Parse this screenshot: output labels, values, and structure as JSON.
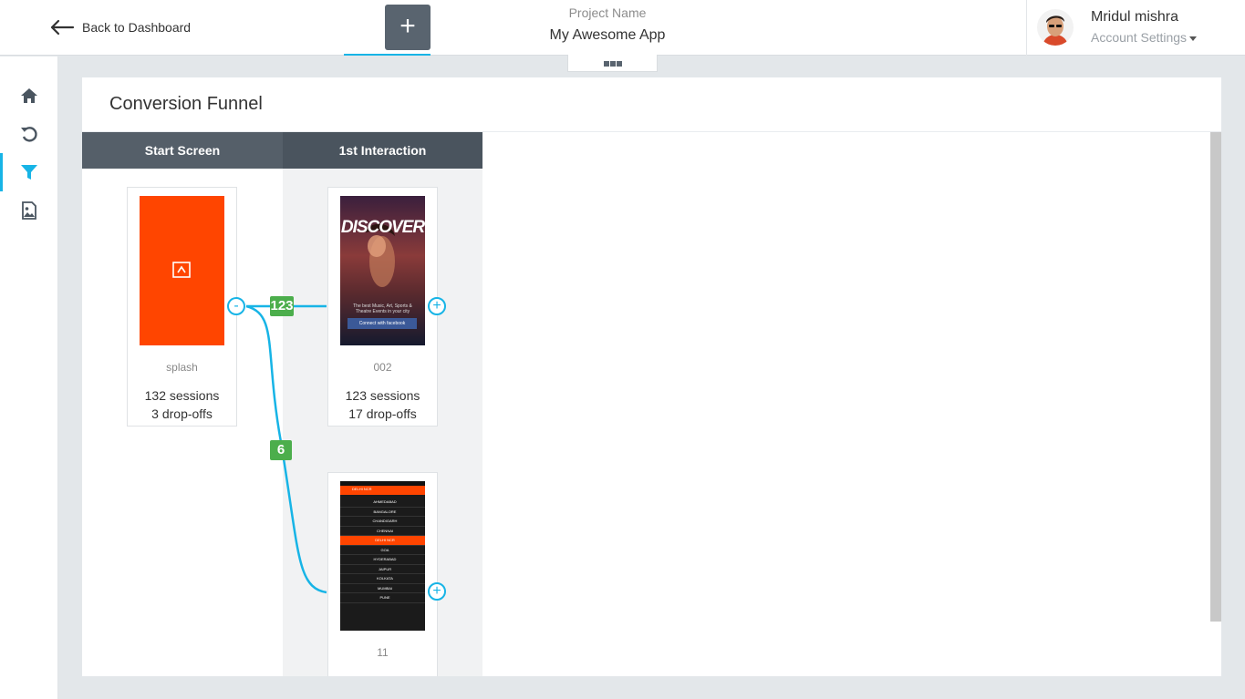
{
  "header": {
    "back_label": "Back to Dashboard",
    "add_label": "+",
    "project_label": "Project Name",
    "project_name": "My Awesome App",
    "user_name": "Mridul mishra",
    "account_settings": "Account Settings"
  },
  "sidebar": {
    "items": [
      {
        "name": "home-icon"
      },
      {
        "name": "history-icon"
      },
      {
        "name": "funnel-icon",
        "active": true
      },
      {
        "name": "image-icon"
      }
    ]
  },
  "funnel": {
    "title": "Conversion Funnel",
    "columns": [
      "Start Screen",
      "1st Interaction"
    ],
    "screens": [
      {
        "name": "splash",
        "sessions": "132 sessions",
        "dropoffs": "3 drop-offs"
      },
      {
        "name": "002",
        "sessions": "123 sessions",
        "dropoffs": "17 drop-offs"
      },
      {
        "name": "11"
      }
    ],
    "links": [
      {
        "count": "123"
      },
      {
        "count": "6"
      }
    ],
    "collapse_label": "-",
    "expand_label": "+"
  },
  "thumbnails": {
    "discover_title": "DISCOVER",
    "discover_text": "The best Music, Art, Sports & Theatre Events in your city",
    "discover_button": "Connect with facebook",
    "cities": [
      "AHMEDABAD",
      "BANGALORE",
      "CHANDIGARH",
      "CHENNAI",
      "DELHI NCR",
      "GOA",
      "HYDERABAD",
      "JAIPUR",
      "KOLKATA",
      "MUMBAI",
      "PUNE"
    ],
    "city_header": "DELHI NCR"
  },
  "colors": {
    "accent": "#17b4e6",
    "badge": "#4cae4c",
    "splash": "#ff4500",
    "header_col": "#555f69"
  }
}
